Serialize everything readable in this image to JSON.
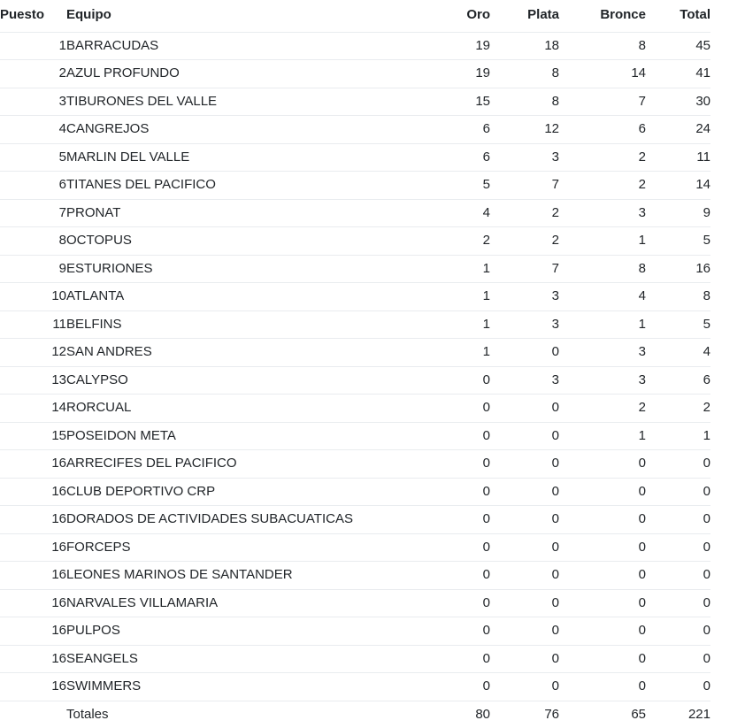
{
  "table": {
    "columns": [
      {
        "key": "puesto",
        "label": "Puesto",
        "align": "left"
      },
      {
        "key": "equipo",
        "label": "Equipo",
        "align": "left"
      },
      {
        "key": "oro",
        "label": "Oro",
        "align": "right"
      },
      {
        "key": "plata",
        "label": "Plata",
        "align": "right"
      },
      {
        "key": "bronce",
        "label": "Bronce",
        "align": "right"
      },
      {
        "key": "total",
        "label": "Total",
        "align": "right"
      }
    ],
    "rows": [
      {
        "puesto": "1",
        "equipo": "BARRACUDAS",
        "oro": "19",
        "plata": "18",
        "bronce": "8",
        "total": "45"
      },
      {
        "puesto": "2",
        "equipo": "AZUL PROFUNDO",
        "oro": "19",
        "plata": "8",
        "bronce": "14",
        "total": "41"
      },
      {
        "puesto": "3",
        "equipo": "TIBURONES DEL VALLE",
        "oro": "15",
        "plata": "8",
        "bronce": "7",
        "total": "30"
      },
      {
        "puesto": "4",
        "equipo": "CANGREJOS",
        "oro": "6",
        "plata": "12",
        "bronce": "6",
        "total": "24"
      },
      {
        "puesto": "5",
        "equipo": "MARLIN DEL VALLE",
        "oro": "6",
        "plata": "3",
        "bronce": "2",
        "total": "11"
      },
      {
        "puesto": "6",
        "equipo": "TITANES DEL PACIFICO",
        "oro": "5",
        "plata": "7",
        "bronce": "2",
        "total": "14"
      },
      {
        "puesto": "7",
        "equipo": "PRONAT",
        "oro": "4",
        "plata": "2",
        "bronce": "3",
        "total": "9"
      },
      {
        "puesto": "8",
        "equipo": "OCTOPUS",
        "oro": "2",
        "plata": "2",
        "bronce": "1",
        "total": "5"
      },
      {
        "puesto": "9",
        "equipo": "ESTURIONES",
        "oro": "1",
        "plata": "7",
        "bronce": "8",
        "total": "16"
      },
      {
        "puesto": "10",
        "equipo": "ATLANTA",
        "oro": "1",
        "plata": "3",
        "bronce": "4",
        "total": "8"
      },
      {
        "puesto": "11",
        "equipo": "BELFINS",
        "oro": "1",
        "plata": "3",
        "bronce": "1",
        "total": "5"
      },
      {
        "puesto": "12",
        "equipo": "SAN ANDRES",
        "oro": "1",
        "plata": "0",
        "bronce": "3",
        "total": "4"
      },
      {
        "puesto": "13",
        "equipo": "CALYPSO",
        "oro": "0",
        "plata": "3",
        "bronce": "3",
        "total": "6"
      },
      {
        "puesto": "14",
        "equipo": "RORCUAL",
        "oro": "0",
        "plata": "0",
        "bronce": "2",
        "total": "2"
      },
      {
        "puesto": "15",
        "equipo": "POSEIDON META",
        "oro": "0",
        "plata": "0",
        "bronce": "1",
        "total": "1"
      },
      {
        "puesto": "16",
        "equipo": "ARRECIFES DEL PACIFICO",
        "oro": "0",
        "plata": "0",
        "bronce": "0",
        "total": "0"
      },
      {
        "puesto": "16",
        "equipo": "CLUB DEPORTIVO CRP",
        "oro": "0",
        "plata": "0",
        "bronce": "0",
        "total": "0"
      },
      {
        "puesto": "16",
        "equipo": "DORADOS DE ACTIVIDADES SUBACUATICAS",
        "oro": "0",
        "plata": "0",
        "bronce": "0",
        "total": "0"
      },
      {
        "puesto": "16",
        "equipo": "FORCEPS",
        "oro": "0",
        "plata": "0",
        "bronce": "0",
        "total": "0"
      },
      {
        "puesto": "16",
        "equipo": "LEONES MARINOS DE SANTANDER",
        "oro": "0",
        "plata": "0",
        "bronce": "0",
        "total": "0"
      },
      {
        "puesto": "16",
        "equipo": "NARVALES VILLAMARIA",
        "oro": "0",
        "plata": "0",
        "bronce": "0",
        "total": "0"
      },
      {
        "puesto": "16",
        "equipo": "PULPOS",
        "oro": "0",
        "plata": "0",
        "bronce": "0",
        "total": "0"
      },
      {
        "puesto": "16",
        "equipo": "SEANGELS",
        "oro": "0",
        "plata": "0",
        "bronce": "0",
        "total": "0"
      },
      {
        "puesto": "16",
        "equipo": "SWIMMERS",
        "oro": "0",
        "plata": "0",
        "bronce": "0",
        "total": "0"
      }
    ],
    "footer": {
      "puesto": "",
      "equipo": "Totales",
      "oro": "80",
      "plata": "76",
      "bronce": "65",
      "total": "221"
    }
  },
  "colors": {
    "text": "#212529",
    "border": "#e9ecef",
    "background": "#ffffff"
  }
}
